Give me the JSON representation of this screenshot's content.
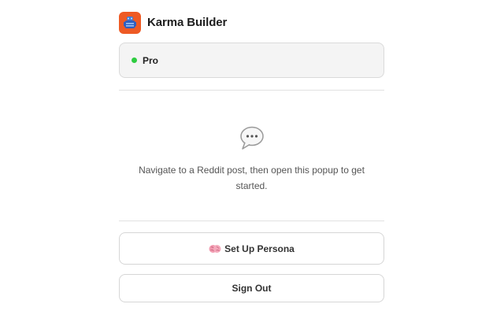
{
  "app": {
    "title": "Karma Builder",
    "logo_icon": "robot-icon",
    "brand_color": "#ee5a24"
  },
  "plan": {
    "label": "Pro",
    "status_color": "#2ecc40"
  },
  "empty_state": {
    "icon": "speech-bubble-icon",
    "message": "Navigate to a Reddit post, then open this popup to get started."
  },
  "actions": {
    "persona_icon": "brain-icon",
    "persona_label": "Set Up Persona",
    "sign_out_label": "Sign Out"
  }
}
